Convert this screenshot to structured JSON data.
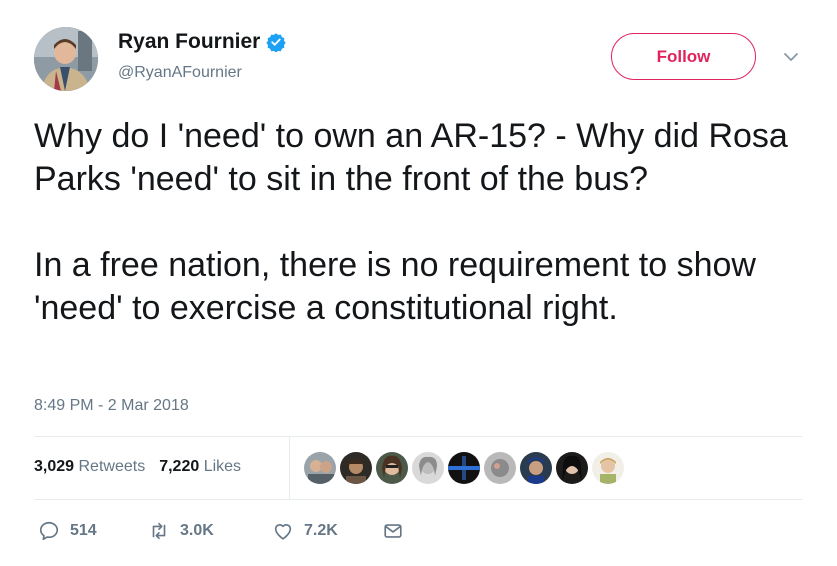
{
  "user": {
    "name": "Ryan Fournier",
    "handle": "@RyanAFournier"
  },
  "follow_label": "Follow",
  "tweet": {
    "paragraphs": [
      "Why do I 'need' to own an AR-15? - Why did Rosa Parks 'need' to sit in the front of the bus?",
      "In a free nation, there is no requirement to show 'need' to exercise a constitutional right."
    ],
    "timestamp": "8:49 PM - 2 Mar 2018"
  },
  "stats": {
    "retweets_count": "3,029",
    "retweets_label": "Retweets",
    "likes_count": "7,220",
    "likes_label": "Likes"
  },
  "actions": {
    "replies": "514",
    "retweets": "3.0K",
    "likes": "7.2K"
  },
  "colors": {
    "accent": "#e0245e",
    "verified": "#1da1f2",
    "secondary_text": "#657786"
  },
  "icons": [
    "verified-icon",
    "chevron-down-icon",
    "reply-icon",
    "retweet-icon",
    "like-icon",
    "message-icon"
  ]
}
